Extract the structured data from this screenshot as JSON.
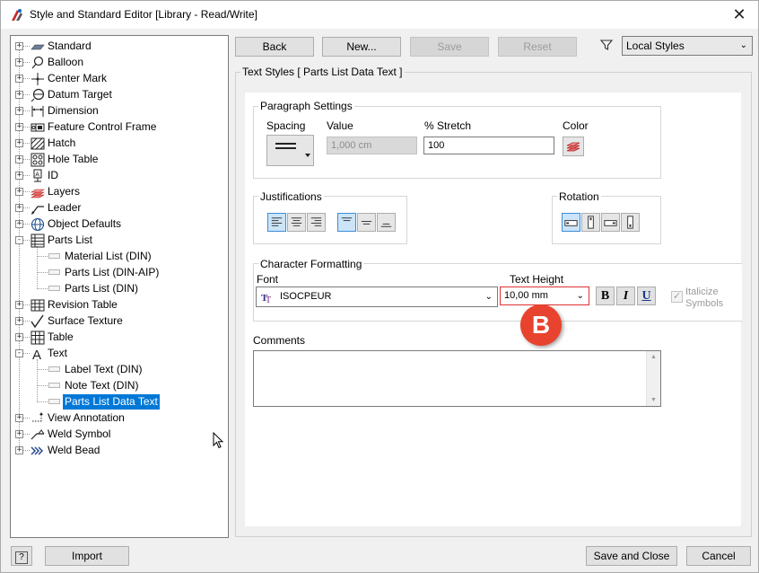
{
  "window": {
    "title": "Style and Standard Editor [Library - Read/Write]"
  },
  "tree": {
    "items": [
      {
        "label": "Standard",
        "icon": "standard-icon",
        "expander": "+"
      },
      {
        "label": "Balloon",
        "icon": "balloon-icon",
        "expander": "+"
      },
      {
        "label": "Center Mark",
        "icon": "center-mark-icon",
        "expander": "+"
      },
      {
        "label": "Datum Target",
        "icon": "datum-target-icon",
        "expander": "+"
      },
      {
        "label": "Dimension",
        "icon": "dimension-icon",
        "expander": "+"
      },
      {
        "label": "Feature Control Frame",
        "icon": "feature-control-frame-icon",
        "expander": "+"
      },
      {
        "label": "Hatch",
        "icon": "hatch-icon",
        "expander": "+"
      },
      {
        "label": "Hole Table",
        "icon": "hole-table-icon",
        "expander": "+"
      },
      {
        "label": "ID",
        "icon": "id-icon",
        "expander": "+"
      },
      {
        "label": "Layers",
        "icon": "layers-icon",
        "expander": "+"
      },
      {
        "label": "Leader",
        "icon": "leader-icon",
        "expander": "+"
      },
      {
        "label": "Object Defaults",
        "icon": "object-defaults-icon",
        "expander": "+"
      },
      {
        "label": "Parts List",
        "icon": "parts-list-icon",
        "expander": "-"
      },
      {
        "label": "Material List (DIN)",
        "child": true
      },
      {
        "label": "Parts List (DIN-AIP)",
        "child": true
      },
      {
        "label": "Parts List (DIN)",
        "child": true
      },
      {
        "label": "Revision Table",
        "icon": "revision-table-icon",
        "expander": "+"
      },
      {
        "label": "Surface Texture",
        "icon": "surface-texture-icon",
        "expander": "+"
      },
      {
        "label": "Table",
        "icon": "table-icon",
        "expander": "+"
      },
      {
        "label": "Text",
        "icon": "text-icon",
        "expander": "-"
      },
      {
        "label": "Label Text (DIN)",
        "child": true
      },
      {
        "label": "Note Text (DIN)",
        "child": true
      },
      {
        "label": "Parts List Data Text",
        "child": true,
        "selected": true
      },
      {
        "label": "View Annotation",
        "icon": "view-annotation-icon",
        "expander": "+"
      },
      {
        "label": "Weld Symbol",
        "icon": "weld-symbol-icon",
        "expander": "+"
      },
      {
        "label": "Weld Bead",
        "icon": "weld-bead-icon",
        "expander": "+"
      }
    ]
  },
  "toolbar": {
    "back": "Back",
    "new": "New...",
    "save": "Save",
    "reset": "Reset",
    "filter_value": "Local Styles"
  },
  "panel": {
    "title": "Text Styles [ Parts List Data Text ]"
  },
  "paragraph": {
    "title": "Paragraph Settings",
    "spacing_label": "Spacing",
    "value_label": "Value",
    "value": "1,000 cm",
    "stretch_label": "% Stretch",
    "stretch": "100",
    "color_label": "Color"
  },
  "justifications": {
    "title": "Justifications"
  },
  "rotation": {
    "title": "Rotation"
  },
  "character": {
    "title": "Character Formatting",
    "font_label": "Font",
    "font": "ISOCPEUR",
    "height_label": "Text Height",
    "height": "10,00 mm",
    "bold": "B",
    "italic": "I",
    "underline": "U",
    "italicize_line1": "Italicize",
    "italicize_line2": "Symbols"
  },
  "comments": {
    "label": "Comments",
    "value": ""
  },
  "annotation": {
    "badge": "B",
    "color": "#e8432e"
  },
  "footer": {
    "help": "?",
    "import": "Import",
    "save_close": "Save and Close",
    "cancel": "Cancel"
  },
  "colors": {
    "accent": "#0078d7",
    "highlight_border": "#e03030"
  }
}
